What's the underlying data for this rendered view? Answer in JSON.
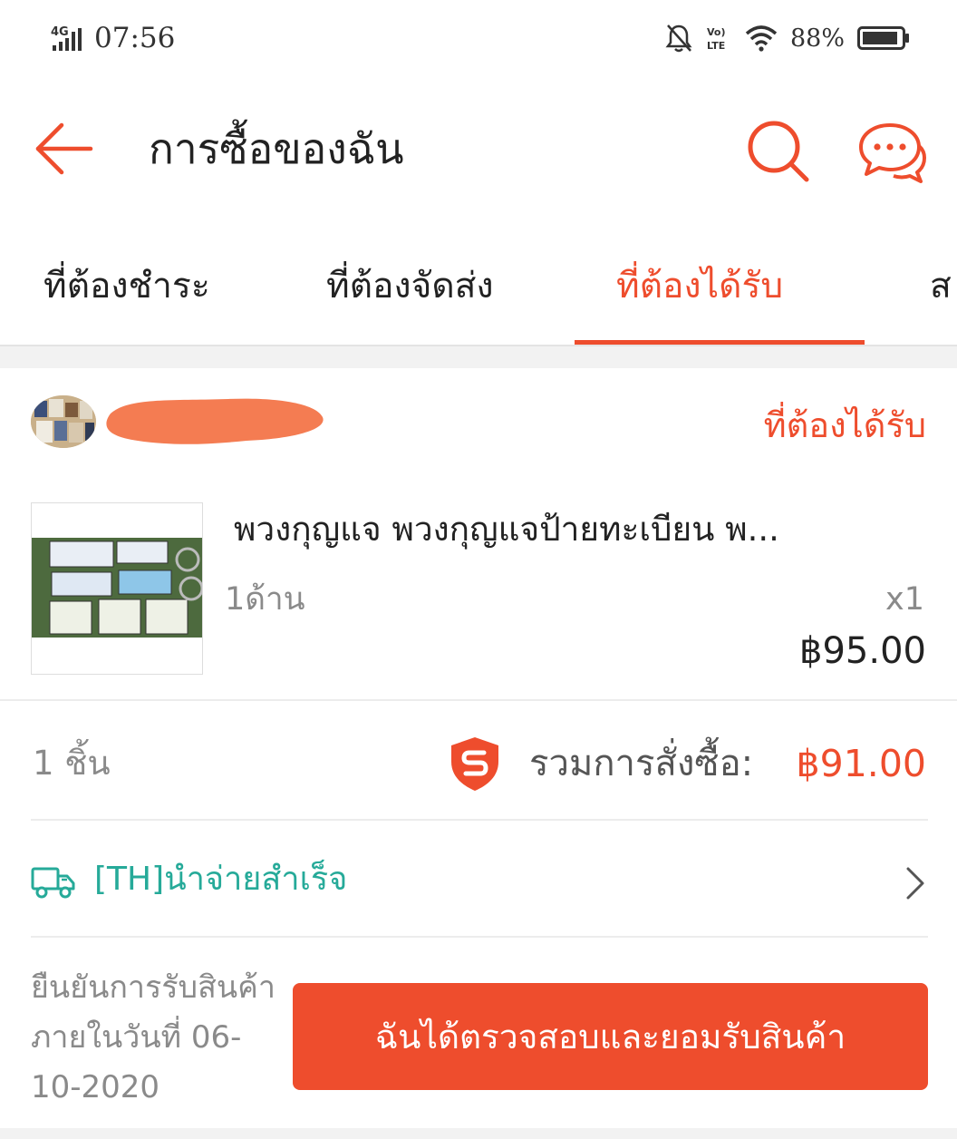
{
  "status_bar": {
    "network": "4G",
    "time": "07:56",
    "volte": "LTE",
    "battery": "88%"
  },
  "header": {
    "title": "การซื้อของฉัน"
  },
  "tabs": [
    {
      "label": "ที่ต้องชำระ",
      "active": false
    },
    {
      "label": "ที่ต้องจัดส่ง",
      "active": false
    },
    {
      "label": "ที่ต้องได้รับ",
      "active": true
    },
    {
      "label": "ส",
      "active": false
    }
  ],
  "order": {
    "status": "ที่ต้องได้รับ",
    "product": {
      "name": "พวงกุญแจ พวงกุญแจป้ายทะเบียน พ...",
      "variant": "1ด้าน",
      "quantity": "x1",
      "price": "฿95.00"
    },
    "item_count": "1 ชิ้น",
    "total_label": "รวมการสั่งซื้อ:",
    "total_amount": "฿91.00",
    "shipping_status": "[TH]นำจ่ายสำเร็จ",
    "confirm_note": "ยืนยันการรับสินค้าภายในวันที่ 06-10-2020",
    "confirm_button": "ฉันได้ตรวจสอบและยอมรับสินค้า"
  },
  "colors": {
    "accent": "#ee4d2d",
    "shipping": "#26aa99",
    "redaction": "#f47c52"
  },
  "icons": {
    "back": "arrow-left-icon",
    "search": "search-icon",
    "chat": "chat-bubbles-icon",
    "shield": "shopee-guarantee-shield-icon",
    "truck": "truck-icon",
    "chevron": "chevron-right-icon"
  }
}
